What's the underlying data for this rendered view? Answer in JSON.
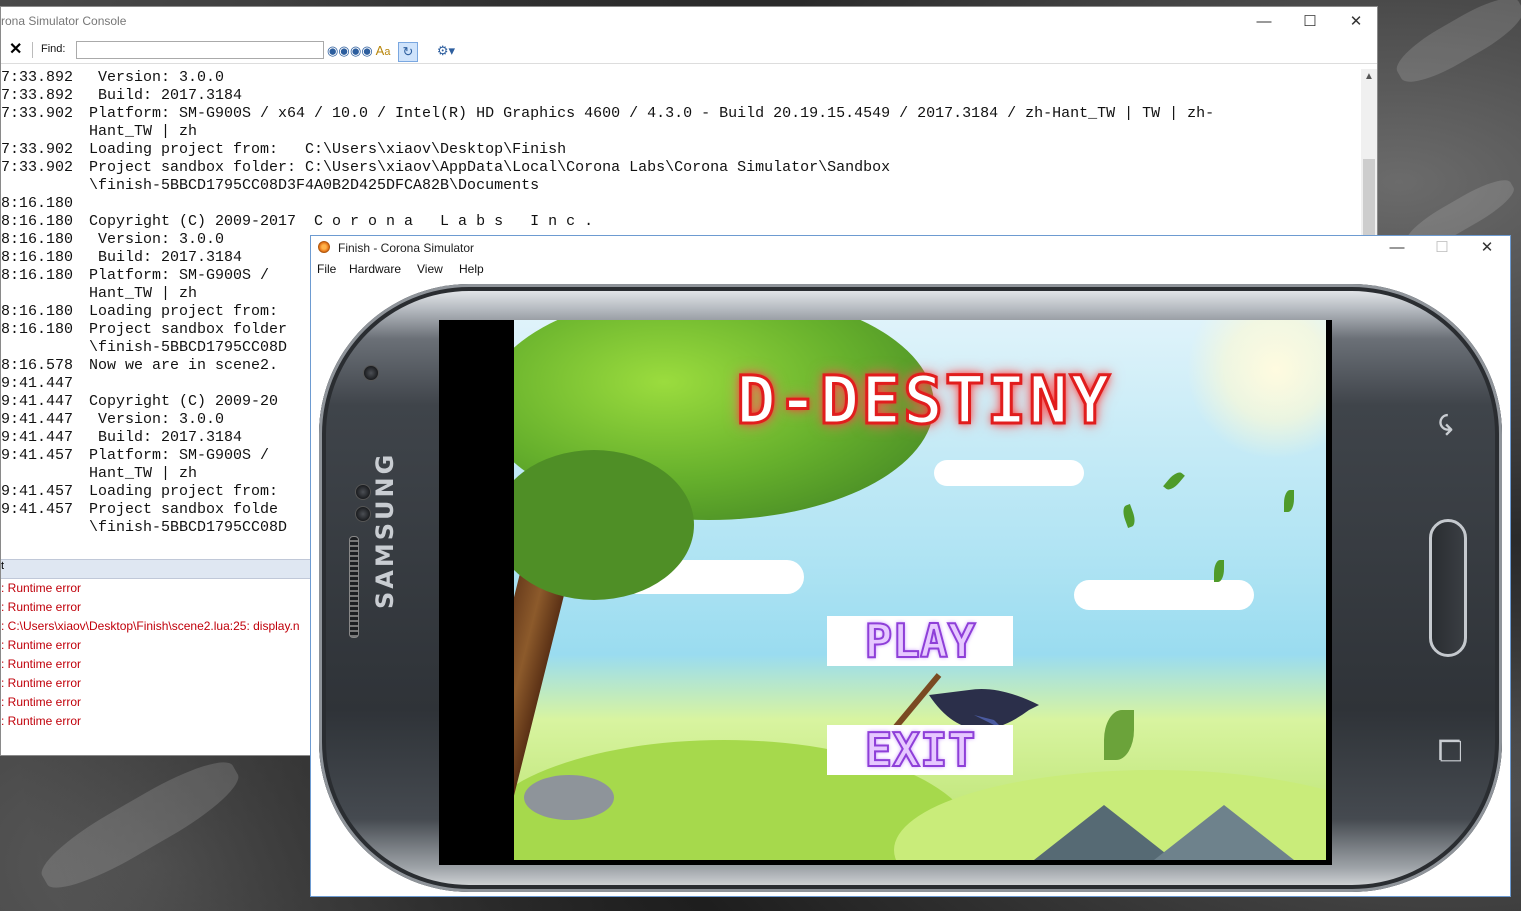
{
  "console": {
    "title": "rona Simulator Console",
    "find_label": "Find:",
    "find_value": "",
    "log_lines": [
      {
        "ts": "7:33.892",
        "msg": " Version: 3.0.0"
      },
      {
        "ts": "7:33.892",
        "msg": " Build: 2017.3184"
      },
      {
        "ts": "7:33.902",
        "msg": "Platform: SM-G900S / x64 / 10.0 / Intel(R) HD Graphics 4600 / 4.3.0 - Build 20.19.15.4549 / 2017.3184 / zh-Hant_TW | TW | zh-"
      },
      {
        "ts": "",
        "msg": "Hant_TW | zh"
      },
      {
        "ts": "7:33.902",
        "msg": "Loading project from:   C:\\Users\\xiaov\\Desktop\\Finish"
      },
      {
        "ts": "7:33.902",
        "msg": "Project sandbox folder: C:\\Users\\xiaov\\AppData\\Local\\Corona Labs\\Corona Simulator\\Sandbox"
      },
      {
        "ts": "",
        "msg": "\\finish-5BBCD1795CC08D3F4A0B2D425DFCA82B\\Documents"
      },
      {
        "ts": "8:16.180",
        "msg": ""
      },
      {
        "ts": "8:16.180",
        "msg": "Copyright (C) 2009-2017  C o r o n a   L a b s   I n c ."
      },
      {
        "ts": "8:16.180",
        "msg": " Version: 3.0.0"
      },
      {
        "ts": "8:16.180",
        "msg": " Build: 2017.3184"
      },
      {
        "ts": "8:16.180",
        "msg": "Platform: SM-G900S /"
      },
      {
        "ts": "",
        "msg": "Hant_TW | zh"
      },
      {
        "ts": "8:16.180",
        "msg": "Loading project from:"
      },
      {
        "ts": "8:16.180",
        "msg": "Project sandbox folder"
      },
      {
        "ts": "",
        "msg": "\\finish-5BBCD1795CC08D"
      },
      {
        "ts": "8:16.578",
        "msg": "Now we are in scene2."
      },
      {
        "ts": "9:41.447",
        "msg": ""
      },
      {
        "ts": "9:41.447",
        "msg": "Copyright (C) 2009-20"
      },
      {
        "ts": "9:41.447",
        "msg": " Version: 3.0.0"
      },
      {
        "ts": "9:41.447",
        "msg": " Build: 2017.3184"
      },
      {
        "ts": "9:41.457",
        "msg": "Platform: SM-G900S /"
      },
      {
        "ts": "",
        "msg": "Hant_TW | zh"
      },
      {
        "ts": "9:41.457",
        "msg": "Loading project from:"
      },
      {
        "ts": "9:41.457",
        "msg": "Project sandbox folde"
      },
      {
        "ts": "",
        "msg": "\\finish-5BBCD1795CC08D"
      }
    ],
    "error_header": "t",
    "errors": [
      ": Runtime error",
      ": Runtime error",
      ": C:\\Users\\xiaov\\Desktop\\Finish\\scene2.lua:25: display.n",
      ": Runtime error",
      ": Runtime error",
      ": Runtime error",
      ": Runtime error",
      ": Runtime error"
    ]
  },
  "simulator": {
    "title": "Finish - Corona Simulator",
    "menu": [
      "File",
      "Hardware",
      "View",
      "Help"
    ],
    "device_brand": "SAMSUNG",
    "game": {
      "title": "D-DESTINY",
      "play_label": "PLAY",
      "exit_label": "EXIT"
    }
  },
  "icons": {
    "console_close": "close-icon",
    "find_next": "binoculars-icon",
    "find_prev": "binoculars-icon",
    "match_case": "match-case-icon",
    "wrap": "wrap-icon",
    "settings": "gear-icon"
  }
}
